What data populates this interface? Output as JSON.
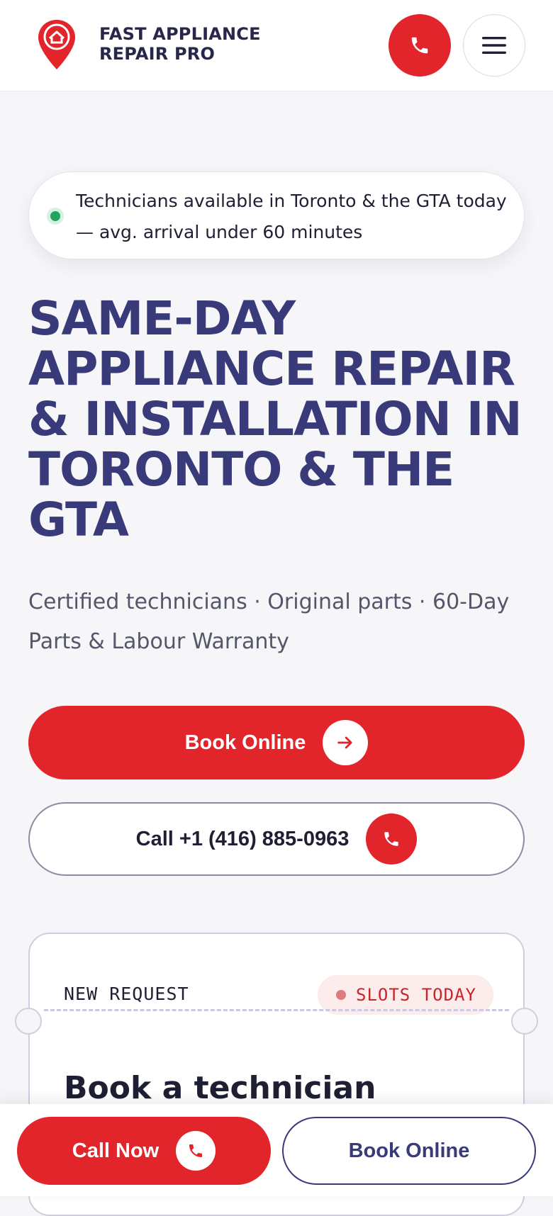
{
  "header": {
    "brand_line1": "FAST APPLIANCE",
    "brand_line2": "REPAIR PRO",
    "logo_icon": "map-pin-house-icon",
    "call_icon": "phone-icon",
    "menu_icon": "hamburger-menu-icon"
  },
  "status": {
    "text": "Technicians available in Toronto & the GTA today — avg. arrival under 60 minutes"
  },
  "hero": {
    "title": "SAME-DAY APPLIANCE REPAIR & INSTALLATION IN TORONTO & THE GTA",
    "subtitle": "Certified technicians · Original parts · 60-Day Parts & Labour Warranty"
  },
  "cta": {
    "book_label": "Book Online",
    "call_label": "Call +1 (416) 885-0963"
  },
  "ticket": {
    "request_label": "NEW REQUEST",
    "badge": "SLOTS TODAY",
    "title": "Book a technician"
  },
  "bottom_bar": {
    "call_label": "Call Now",
    "book_label": "Book Online"
  },
  "colors": {
    "accent_red": "#e2252b",
    "navy": "#383a7a",
    "status_green": "#21a55c",
    "background": "#f6f6f9"
  }
}
